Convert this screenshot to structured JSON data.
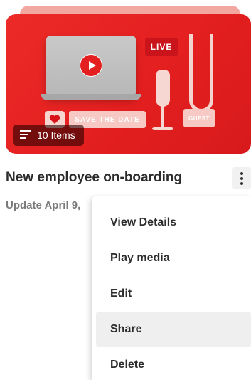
{
  "thumbnail": {
    "live_text": "LIVE",
    "save_date_text": "SAVE THE DATE",
    "guest_text": "GUEST",
    "items_badge": "10 Items",
    "accent_color": "#e31f1f"
  },
  "card": {
    "title": "New employee on-boarding",
    "update_text": "Update April 9,"
  },
  "menu": {
    "items": [
      {
        "label": "View Details"
      },
      {
        "label": "Play media"
      },
      {
        "label": "Edit"
      },
      {
        "label": "Share"
      },
      {
        "label": "Delete"
      }
    ],
    "highlighted": "Share"
  },
  "icons": {
    "list": "list-icon",
    "more": "more-vertical-icon",
    "play": "play-icon",
    "heart": "heart-icon"
  }
}
